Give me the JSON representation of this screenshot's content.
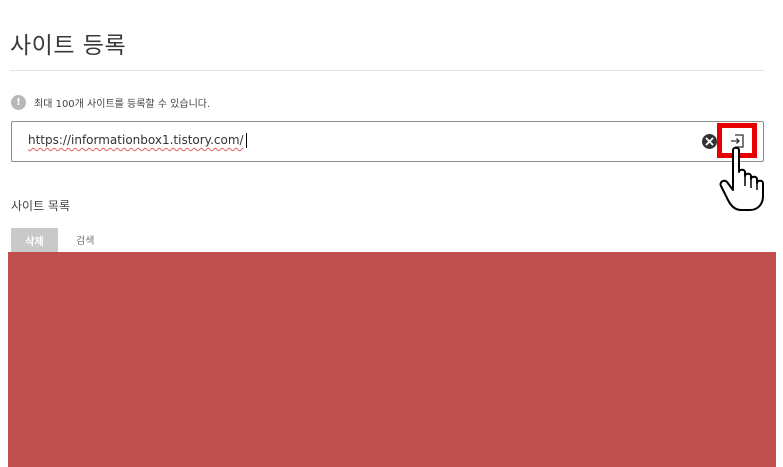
{
  "page": {
    "title": "사이트 등록",
    "notice": "최대 100개 사이트를 등록할 수 있습니다.",
    "notice_icon": "!"
  },
  "url_form": {
    "value": "https://informationbox1.tistory.com/",
    "clear_icon": "close-icon",
    "submit_icon": "enter-icon",
    "highlight_color": "#e60000"
  },
  "site_list": {
    "title": "사이트 목록",
    "tabs": [
      {
        "label": "삭제"
      },
      {
        "label": "검색"
      }
    ],
    "redacted_color": "#bf504e"
  }
}
